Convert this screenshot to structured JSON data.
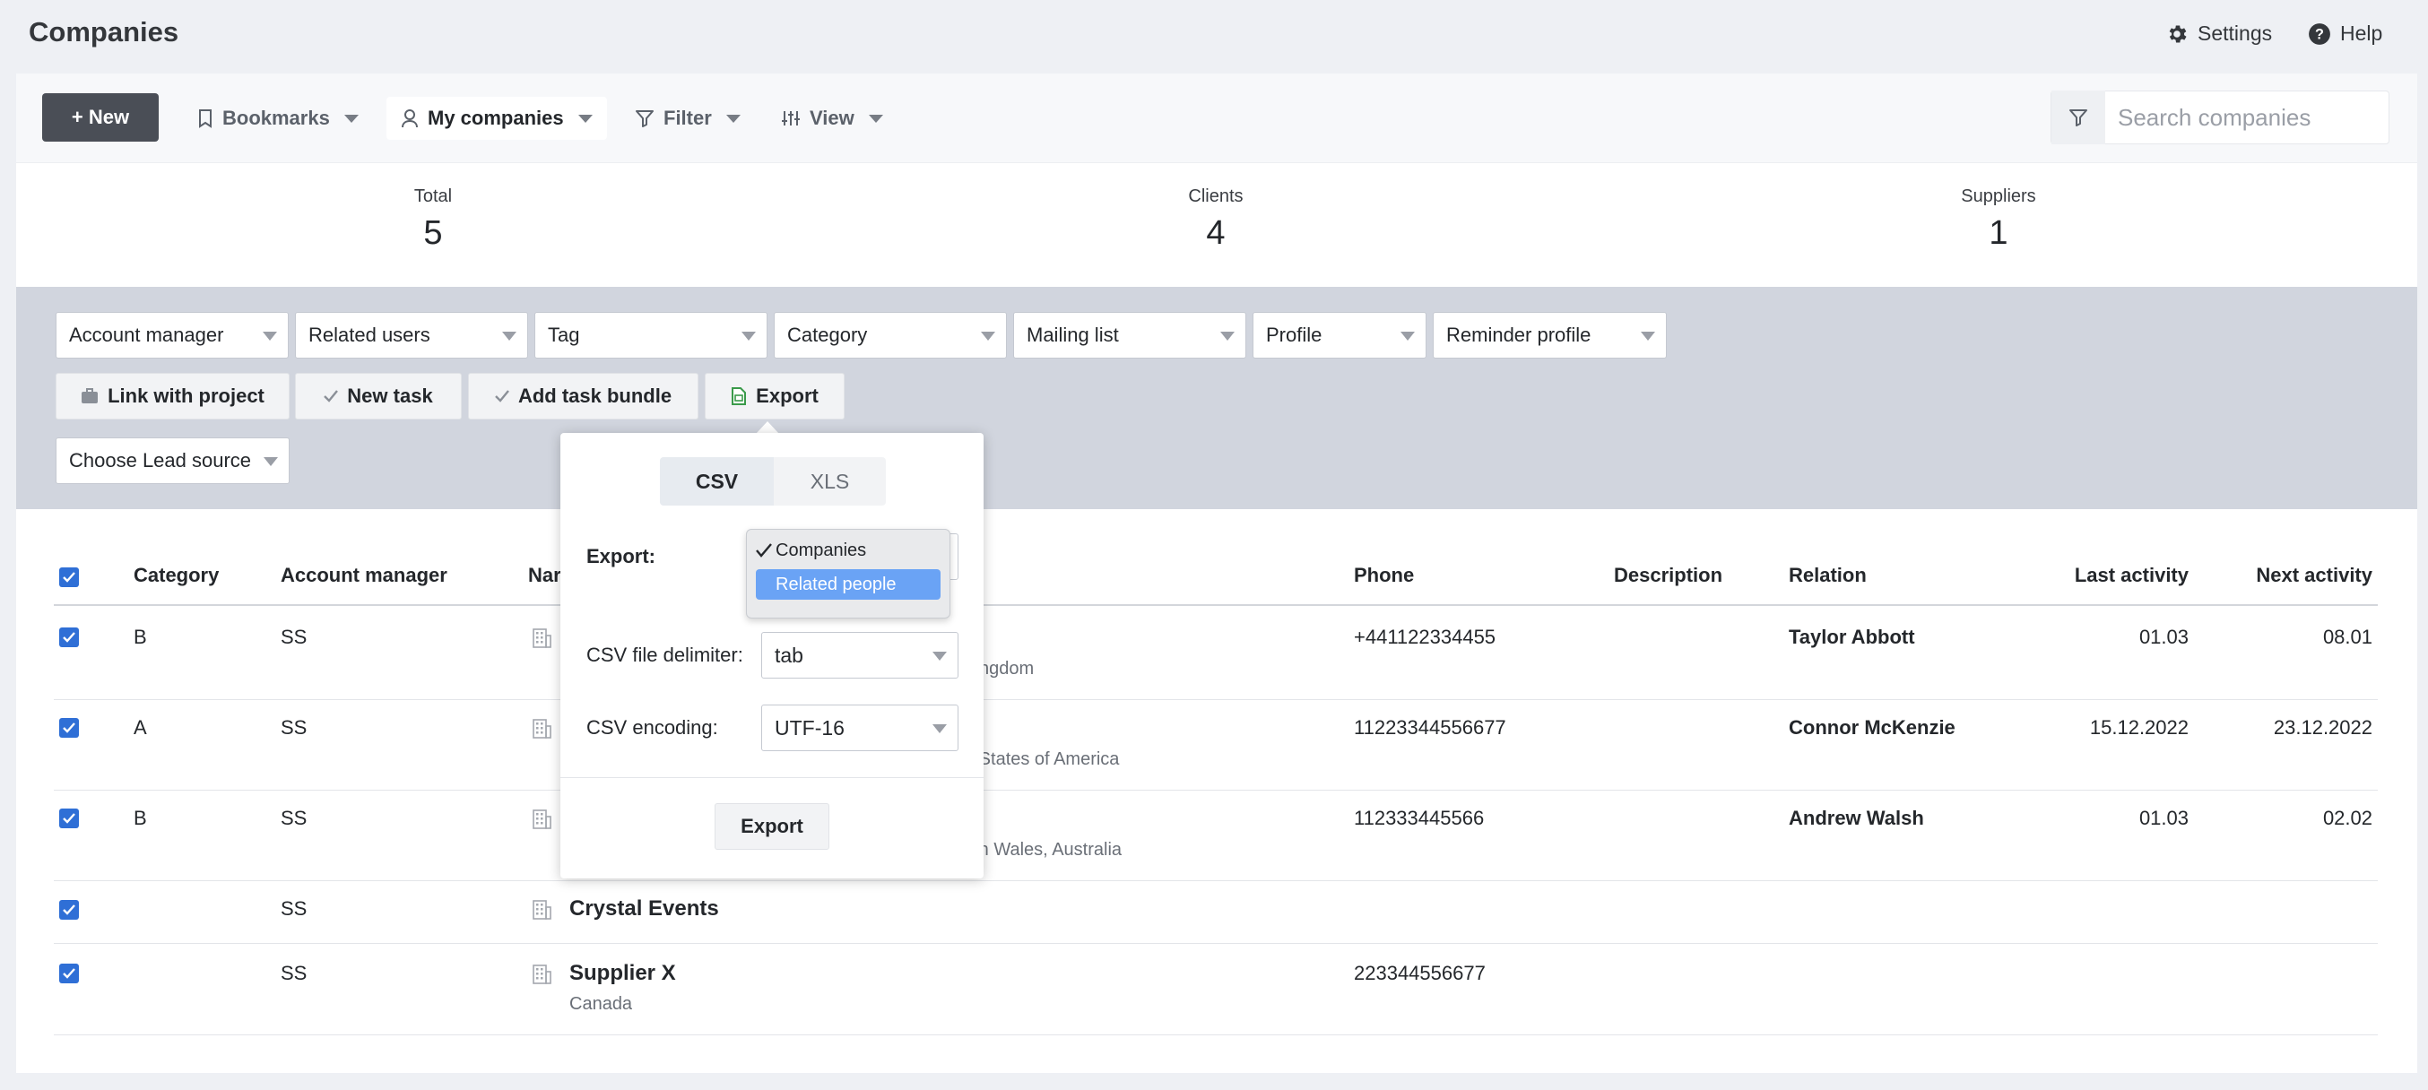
{
  "header": {
    "title": "Companies",
    "settings_label": "Settings",
    "help_label": "Help"
  },
  "toolbar": {
    "new_label": "+ New",
    "bookmarks_label": "Bookmarks",
    "my_companies_label": "My companies",
    "filter_label": "Filter",
    "view_label": "View",
    "search_placeholder": "Search companies"
  },
  "stats": [
    {
      "label": "Total",
      "value": "5"
    },
    {
      "label": "Clients",
      "value": "4"
    },
    {
      "label": "Suppliers",
      "value": "1"
    }
  ],
  "filters": {
    "selects": [
      "Account manager",
      "Related users",
      "Tag",
      "Category",
      "Mailing list",
      "Profile",
      "Reminder profile"
    ],
    "lead_source": "Choose Lead source"
  },
  "actions": {
    "link_project": "Link with project",
    "new_task": "New task",
    "add_task_bundle": "Add task bundle",
    "export": "Export"
  },
  "table": {
    "headers": {
      "category": "Category",
      "account_manager": "Account manager",
      "name": "Nar",
      "phone": "Phone",
      "description": "Description",
      "relation": "Relation",
      "last_activity": "Last activity",
      "next_activity": "Next activity"
    },
    "rows": [
      {
        "checked": true,
        "category": "B",
        "manager": "SS",
        "name": "",
        "location": "ngdom",
        "phone": "+441122334455",
        "description": "",
        "relation": "Taylor Abbott",
        "last": "01.03",
        "next": "08.01"
      },
      {
        "checked": true,
        "category": "A",
        "manager": "SS",
        "name": "",
        "location": "d States of America",
        "phone": "11223344556677",
        "description": "",
        "relation": "Connor McKenzie",
        "last": "15.12.2022",
        "next": "23.12.2022"
      },
      {
        "checked": true,
        "category": "B",
        "manager": "SS",
        "name": "",
        "location": "uth Wales, Australia",
        "phone": "112333445566",
        "description": "",
        "relation": "Andrew Walsh",
        "last": "01.03",
        "next": "02.02"
      },
      {
        "checked": true,
        "category": "",
        "manager": "SS",
        "name": "Crystal Events",
        "location": "",
        "phone": "",
        "description": "",
        "relation": "",
        "last": "",
        "next": ""
      },
      {
        "checked": true,
        "category": "",
        "manager": "SS",
        "name": "Supplier X",
        "location": "Canada",
        "phone": "223344556677",
        "description": "",
        "relation": "",
        "last": "",
        "next": ""
      }
    ]
  },
  "export_popup": {
    "tabs": [
      "CSV",
      "XLS"
    ],
    "active_tab": "CSV",
    "export_label": "Export:",
    "export_options": [
      "Companies",
      "Related people"
    ],
    "export_checked": "Companies",
    "export_highlighted": "Related people",
    "delimiter_label": "CSV file delimiter:",
    "delimiter_value": "tab",
    "encoding_label": "CSV encoding:",
    "encoding_value": "UTF-16",
    "submit_label": "Export"
  },
  "colors": {
    "accent": "#2f6fd6",
    "new_button": "#4a4e56",
    "filter_band": "#d1d5de",
    "dropdown_highlight": "#6aa3f5",
    "export_icon": "#3a9a4a"
  }
}
